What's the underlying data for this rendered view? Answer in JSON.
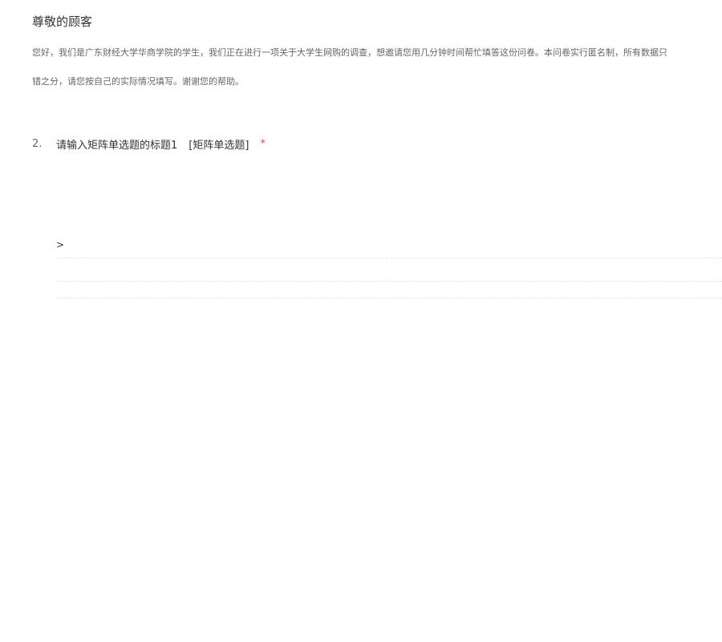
{
  "greeting": "尊敬的顾客",
  "intro": {
    "line1": "您好，我们是广东财经大学华商学院的学生，我们正在进行一项关于大学生网购的调查，想邀请您用几分钟时间帮忙填答这份问卷。本问卷实行匿名制，所有数据只",
    "line2": "错之分，请您按自己的实际情况填写。谢谢您的帮助。"
  },
  "question": {
    "number": "2.",
    "title": "请输入矩阵单选题的标题1",
    "type": "[矩阵单选题]",
    "required_mark": "*"
  },
  "matrix": {
    "row_header": ">"
  },
  "colors": {
    "required": "#e64340",
    "divider": "#e6e6e6"
  }
}
